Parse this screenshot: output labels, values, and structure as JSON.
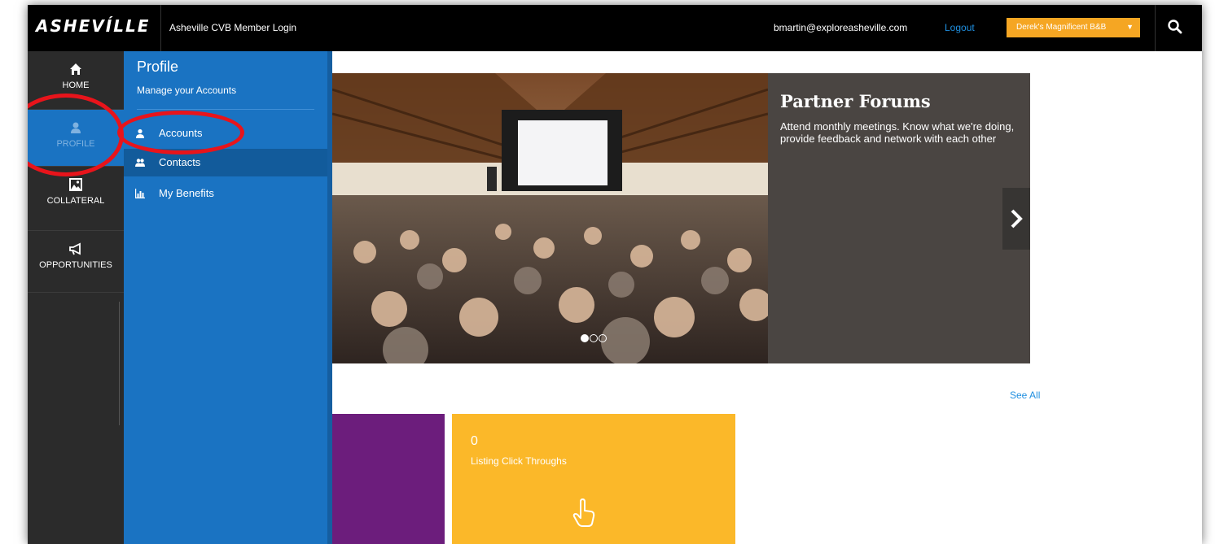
{
  "header": {
    "logo_text": "ASHEVÍLLE",
    "app_title": "Asheville CVB Member Login",
    "user_email": "bmartin@exploreasheville.com",
    "logout_label": "Logout",
    "account_selected": "Derek's Magnificent B&B",
    "account_caret": "▼"
  },
  "leftnav": {
    "items": [
      {
        "label": "HOME",
        "icon": "home-icon"
      },
      {
        "label": "PROFILE",
        "icon": "user-icon"
      },
      {
        "label": "COLLATERAL",
        "icon": "image-icon"
      },
      {
        "label": "OPPORTUNITIES",
        "icon": "megaphone-icon"
      }
    ]
  },
  "flyout": {
    "title": "Profile",
    "subtitle": "Manage your Accounts",
    "items": [
      {
        "label": "Accounts",
        "icon": "user-icon"
      },
      {
        "label": "Contacts",
        "icon": "users-icon"
      },
      {
        "label": "My Benefits",
        "icon": "bar-chart-icon"
      }
    ]
  },
  "hero": {
    "slide_title": "Partner Forums",
    "slide_description": "Attend monthly meetings. Know what we're doing, provide feedback and network with each other",
    "slide_count": 3,
    "active_slide": 1
  },
  "stats": {
    "see_all_label": "See All",
    "tiles": [
      {
        "count": "0",
        "label": "Listing Click Throughs",
        "icon": "hand-pointer-icon"
      }
    ]
  },
  "colors": {
    "topbar": "#000000",
    "leftnav": "#2b2b2b",
    "flyout": "#1a73c2",
    "accent_orange": "#f5a623",
    "tile_purple": "#6c1d7c",
    "tile_yellow": "#fbb829",
    "annotation_red": "#e8141b"
  }
}
